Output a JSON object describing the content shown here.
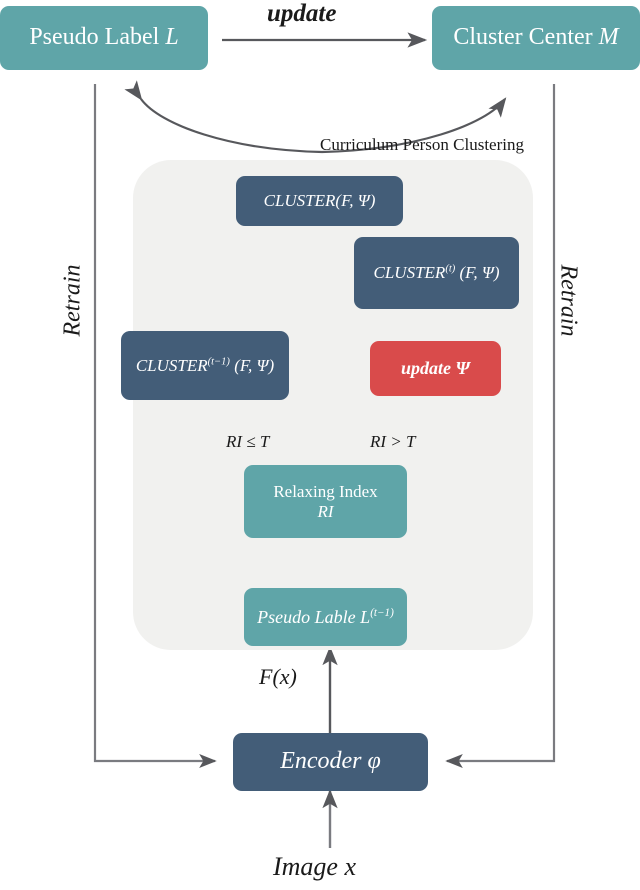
{
  "diagram": {
    "title": "Curriculum Person Clustering pipeline",
    "colors": {
      "teal": "#5FA5A8",
      "navy": "#435D78",
      "red": "#D94B4B",
      "panel": "#f1f1ef",
      "arrow": "#57585c",
      "text": "#1a1a1a"
    }
  },
  "nodes": {
    "pseudo_label": {
      "label": "Pseudo Label ",
      "math": "L"
    },
    "cluster_center": {
      "label": "Cluster Center ",
      "math": "M"
    },
    "cluster_plain": {
      "label": "CLUSTER(F, Ψ)"
    },
    "cluster_t": {
      "label": "CLUSTER",
      "sup": "(t)",
      "args": " (F, Ψ)"
    },
    "cluster_t_minus_1": {
      "label": "CLUSTER",
      "sup": "(t−1)",
      "args": " (F, Ψ)"
    },
    "update_psi": {
      "label": "update Ψ"
    },
    "relaxing_index": {
      "line1": "Relaxing Index",
      "line2": "RI"
    },
    "pseudo_lable_prev": {
      "label": "Pseudo Lable L",
      "sup": "(t−1)"
    },
    "encoder": {
      "label": "Encoder φ"
    }
  },
  "labels": {
    "update_arrow": "update",
    "curriculum": "Curriculum  Person Clustering",
    "retrain_left": "Retrain",
    "retrain_right": "Retrain",
    "condition_left": "RI ≤ T",
    "condition_right": "RI > T",
    "feature_flow": "F(x)",
    "input": "Image x"
  }
}
